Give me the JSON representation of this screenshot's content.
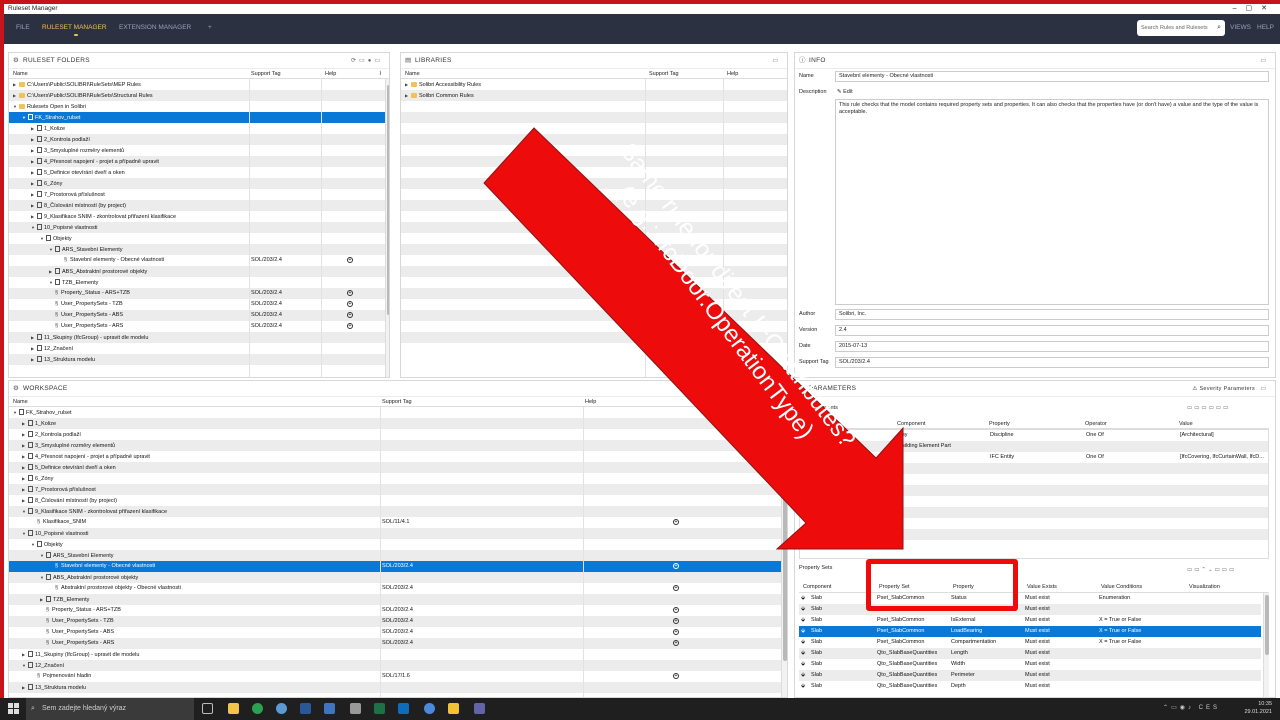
{
  "window": {
    "title": "Ruleset Manager"
  },
  "menu": {
    "items": [
      "FILE",
      "RULESET MANAGER",
      "EXTENSION MANAGER",
      "+"
    ],
    "search_placeholder": "Search Rules and Rulesets",
    "right_items": [
      "VIEWS",
      "HELP"
    ]
  },
  "ruleset_folders": {
    "title": "RULESET FOLDERS",
    "columns": [
      "Name",
      "Support Tag",
      "Help"
    ],
    "rows": [
      {
        "name": "C:\\Users\\Public\\SOLIBRI\\RuleSets\\MEP Rules",
        "tag": "",
        "help": false
      },
      {
        "name": "C:\\Users\\Public\\SOLIBRI\\RuleSets\\Structural Rules",
        "tag": "",
        "help": false
      },
      {
        "name": "Rulesets Open in Solibri",
        "tag": "",
        "help": false
      },
      {
        "name": "FK_Strahov_rulset",
        "tag": "",
        "help": false
      },
      {
        "name": "1_Kolize",
        "tag": "",
        "help": false
      },
      {
        "name": "2_Kontrola podlaží",
        "tag": "",
        "help": false
      },
      {
        "name": "3_Smysluplné rozměry elementů",
        "tag": "",
        "help": false
      },
      {
        "name": "4_Přesnost napojení - projet a případně upravit",
        "tag": "",
        "help": false
      },
      {
        "name": "5_Definice otevírání dveří a oken",
        "tag": "",
        "help": false
      },
      {
        "name": "6_Zóny",
        "tag": "",
        "help": false
      },
      {
        "name": "7_Prostorová příslušnost",
        "tag": "",
        "help": false
      },
      {
        "name": "8_Číslování místností (by project)",
        "tag": "",
        "help": false
      },
      {
        "name": "9_Klasifikace SNIM - zkontrolovat přiřazení klasifikace",
        "tag": "",
        "help": false
      },
      {
        "name": "10_Popisné vlastnosti",
        "tag": "",
        "help": false
      },
      {
        "name": "Objekty",
        "tag": "",
        "help": false
      },
      {
        "name": "ARS_Stavební Elementy",
        "tag": "",
        "help": false
      },
      {
        "name": "Stavební elementy - Obecné vlastnosti",
        "tag": "SOL/203/2.4",
        "help": true
      },
      {
        "name": "ABS_Abstraktní prostorové objekty",
        "tag": "",
        "help": false
      },
      {
        "name": "TZB_Elementy",
        "tag": "",
        "help": false
      },
      {
        "name": "Property_Status - ARS+TZB",
        "tag": "SOL/203/2.4",
        "help": true
      },
      {
        "name": "User_PropertySets - TZB",
        "tag": "SOL/203/2.4",
        "help": true
      },
      {
        "name": "User_PropertySets - ABS",
        "tag": "SOL/203/2.4",
        "help": true
      },
      {
        "name": "User_PropertySets - ARS",
        "tag": "SOL/203/2.4",
        "help": true
      },
      {
        "name": "11_Skupiny (IfcGroup) - upravit dle modelu",
        "tag": "",
        "help": false
      },
      {
        "name": "12_Značení",
        "tag": "",
        "help": false
      },
      {
        "name": "13_Struktura modelu",
        "tag": "",
        "help": false
      }
    ]
  },
  "libraries": {
    "title": "LIBRARIES",
    "columns": [
      "Name",
      "Support Tag",
      "Help"
    ],
    "rows": [
      {
        "name": "Solibri Accessibility Rules"
      },
      {
        "name": "Solibri Common Rules"
      }
    ]
  },
  "info": {
    "title": "INFO",
    "name_label": "Name",
    "name_value": "Stavební elementy - Obecné vlastnosti",
    "description_label": "Description",
    "edit_label": "Edit",
    "description_value": "This rule checks that the model contains required property sets and properties. It can also checks that the properties have (or don't have) a value and the type of the value is acceptable.",
    "author_label": "Author",
    "author_value": "Solibri, Inc.",
    "version_label": "Version",
    "version_value": "2.4",
    "date_label": "Date",
    "date_value": "2015-07-13",
    "support_label": "Support Tag",
    "support_value": "SOL/203/2.4"
  },
  "workspace": {
    "title": "WORKSPACE",
    "columns": [
      "Name",
      "Support Tag",
      "Help"
    ],
    "rows": [
      {
        "name": "FK_Strahov_rulset",
        "tag": "",
        "help": false
      },
      {
        "name": "1_Kolize",
        "tag": "",
        "help": false
      },
      {
        "name": "2_Kontrola podlaží",
        "tag": "",
        "help": false
      },
      {
        "name": "3_Smysluplné rozměry elementů",
        "tag": "",
        "help": false
      },
      {
        "name": "4_Přesnost napojení - projet a případně upravit",
        "tag": "",
        "help": false
      },
      {
        "name": "5_Definice otevírání dveří a oken",
        "tag": "",
        "help": false
      },
      {
        "name": "6_Zóny",
        "tag": "",
        "help": false
      },
      {
        "name": "7_Prostorová příslušnost",
        "tag": "",
        "help": false
      },
      {
        "name": "8_Číslování místností (by project)",
        "tag": "",
        "help": false
      },
      {
        "name": "9_Klasifikace SNIM - zkontrolovat přiřazení klasifikace",
        "tag": "",
        "help": false
      },
      {
        "name": "Klasifikace_SNIM",
        "tag": "SOL/11/4.1",
        "help": true
      },
      {
        "name": "10_Popisné vlastnosti",
        "tag": "",
        "help": false
      },
      {
        "name": "Objekty",
        "tag": "",
        "help": false
      },
      {
        "name": "ARS_Stavební Elementy",
        "tag": "",
        "help": false
      },
      {
        "name": "Stavební elementy - Obecné vlastnosti",
        "tag": "SOL/203/2.4",
        "help": true
      },
      {
        "name": "ABS_Abstraktní prostorové objekty",
        "tag": "",
        "help": false
      },
      {
        "name": "Abstraktní prostorové objekty - Obecné vlastnosti",
        "tag": "SOL/203/2.4",
        "help": true
      },
      {
        "name": "TZB_Elementy",
        "tag": "",
        "help": false
      },
      {
        "name": "Property_Status - ARS+TZB",
        "tag": "SOL/203/2.4",
        "help": true
      },
      {
        "name": "User_PropertySets - TZB",
        "tag": "SOL/203/2.4",
        "help": true
      },
      {
        "name": "User_PropertySets - ABS",
        "tag": "SOL/203/2.4",
        "help": true
      },
      {
        "name": "User_PropertySets - ARS",
        "tag": "SOL/203/2.4",
        "help": true
      },
      {
        "name": "11_Skupiny (IfcGroup) - upravit dle modelu",
        "tag": "",
        "help": false
      },
      {
        "name": "12_Značení",
        "tag": "",
        "help": false
      },
      {
        "name": "Pojmenování hladin",
        "tag": "SOL/17/1.6",
        "help": true
      },
      {
        "name": "13_Struktura modelu",
        "tag": "",
        "help": false
      }
    ]
  },
  "parameters": {
    "title": "PARAMETERS",
    "severity_label": "Severity Parameters",
    "checked_label": "ed Components",
    "comp_columns": [
      "Component",
      "Property",
      "Operator",
      "Value"
    ],
    "comp_rows": [
      {
        "component": "Any",
        "property": "Discipline",
        "operator": "One Of",
        "value": "[Architectural]"
      },
      {
        "component": "Building Element Part",
        "property": "",
        "operator": "",
        "value": ""
      },
      {
        "component": "",
        "property": "IFC Entity",
        "operator": "One Of",
        "value": "[IfcCovering, IfcCurtainWall, IfcD..."
      }
    ],
    "psets_label": "Property Sets",
    "pset_columns": [
      "Component",
      "Property Set",
      "Property",
      "Value Exists",
      "Value Conditions",
      "Visualization"
    ],
    "pset_rows": [
      {
        "component": "Slab",
        "pset": "Pset_SlabCommon",
        "property": "Status",
        "exists": "Must exist",
        "conditions": "Enumeration"
      },
      {
        "component": "Slab",
        "pset": "",
        "property": "",
        "exists": "Must exist",
        "conditions": ""
      },
      {
        "component": "Slab",
        "pset": "Pset_SlabCommon",
        "property": "IsExternal",
        "exists": "Must exist",
        "conditions": "X = True or False"
      },
      {
        "component": "Slab",
        "pset": "Pset_SlabCommon",
        "property": "LoadBearing",
        "exists": "Must exist",
        "conditions": "X = True or False"
      },
      {
        "component": "Slab",
        "pset": "Pset_SlabCommon",
        "property": "Compartmentation",
        "exists": "Must exist",
        "conditions": "X = True or False"
      },
      {
        "component": "Slab",
        "pset": "Qto_SlabBaseQuantities",
        "property": "Length",
        "exists": "Must exist",
        "conditions": ""
      },
      {
        "component": "Slab",
        "pset": "Qto_SlabBaseQuantities",
        "property": "Width",
        "exists": "Must exist",
        "conditions": ""
      },
      {
        "component": "Slab",
        "pset": "Qto_SlabBaseQuantities",
        "property": "Perimeter",
        "exists": "Must exist",
        "conditions": ""
      },
      {
        "component": "Slab",
        "pset": "Qto_SlabBaseQuantities",
        "property": "Depth",
        "exists": "Must exist",
        "conditions": ""
      }
    ]
  },
  "annotation": {
    "line1": "Same rule for direct IFC attributes?",
    "line2": "(e.g.: IfcDoor.OperationType)",
    "color": "#ee0b0b"
  },
  "taskbar": {
    "search_placeholder": "Sem zadejte hledaný výraz",
    "language": "CES",
    "time": "10:35",
    "date": "29.01.2021"
  }
}
